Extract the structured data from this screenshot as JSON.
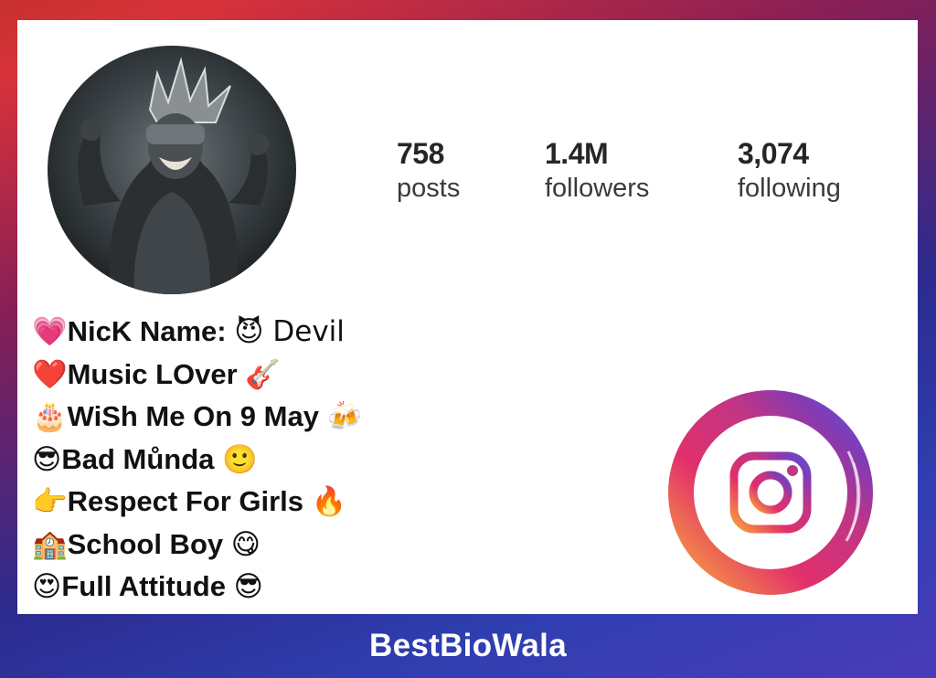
{
  "profile": {
    "stats": [
      {
        "value": "758",
        "label": "posts"
      },
      {
        "value": "1.4M",
        "label": "followers"
      },
      {
        "value": "3,074",
        "label": "following"
      }
    ]
  },
  "bio": [
    {
      "prefix": "💗",
      "text": "NicK Name: ",
      "suffix": "😈 Devil"
    },
    {
      "prefix": "❤️",
      "text": "Music LOver ",
      "suffix": "🎸"
    },
    {
      "prefix": "🎂",
      "text": "WiSh Me On 9 May ",
      "suffix": "🍻"
    },
    {
      "prefix": "😎",
      "text": "Bad Můnda ",
      "suffix": "🙂"
    },
    {
      "prefix": "👉",
      "text": "Respect For Girls ",
      "suffix": "🔥"
    },
    {
      "prefix": "🏫",
      "text": "School Boy ",
      "suffix": "😋"
    },
    {
      "prefix": "😍",
      "text": "Full Attitude ",
      "suffix": "😎"
    }
  ],
  "footer": {
    "brand": "BestBioWala"
  },
  "icons": {
    "profile_image": "avatar-image",
    "logo": "instagram-icon"
  },
  "colors": {
    "frame_top": "#c8312e",
    "frame_bottom": "#2f3fb0",
    "ig_gradient": [
      "#f9a23d",
      "#e1306c",
      "#c13584",
      "#833ab4",
      "#5b51d8"
    ]
  }
}
